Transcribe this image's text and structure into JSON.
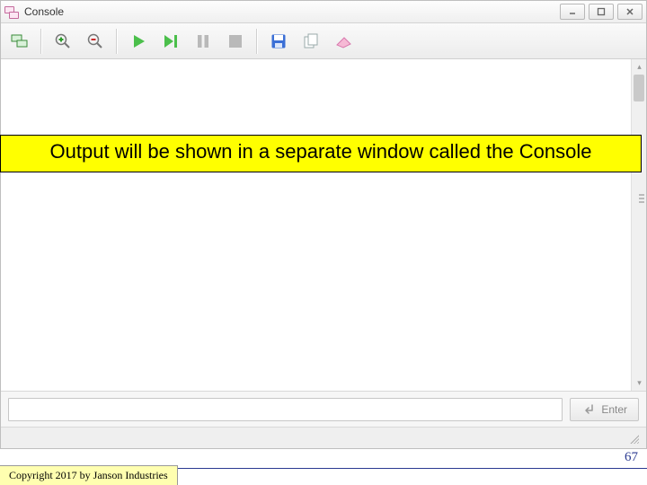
{
  "window": {
    "title": "Console"
  },
  "input": {
    "value": "",
    "placeholder": "",
    "enter_label": "Enter"
  },
  "annotation": {
    "text": "Output will be shown in a separate window called the Console"
  },
  "slide": {
    "page_number": "67",
    "copyright": "Copyright 2017 by Janson Industries"
  },
  "icons": {
    "app": "console-panes",
    "minimize": "minimize",
    "maximize": "maximize",
    "close": "close",
    "tool_panes": "panes",
    "tool_zoom_in": "zoom-in",
    "tool_zoom_out": "zoom-out",
    "tool_run": "run",
    "tool_run_to": "run-to-end",
    "tool_pause": "pause",
    "tool_stop": "stop",
    "tool_save": "save",
    "tool_copy": "copy",
    "tool_erase": "erase",
    "enter_arrow": "return-arrow"
  }
}
